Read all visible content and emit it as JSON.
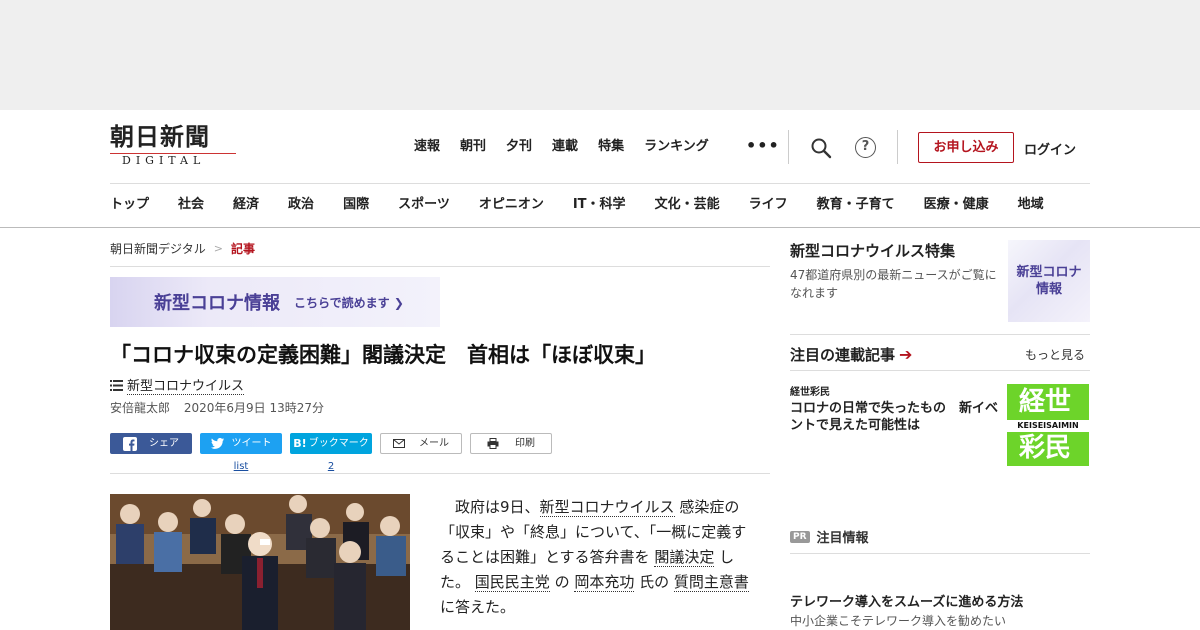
{
  "logo": {
    "kanji": "朝日新聞",
    "digital": "DIGITAL"
  },
  "topnav": [
    "速報",
    "朝刊",
    "夕刊",
    "連載",
    "特集",
    "ランキング"
  ],
  "more_glyph": "•••",
  "help_glyph": "?",
  "apply_label": "お申し込み",
  "login_label": "ログイン",
  "catnav": [
    "トップ",
    "社会",
    "経済",
    "政治",
    "国際",
    "スポーツ",
    "オピニオン",
    "IT・科学",
    "文化・芸能",
    "ライフ",
    "教育・子育て",
    "医療・健康",
    "地域"
  ],
  "breadcrumb": {
    "home": "朝日新聞デジタル",
    "sep": ">",
    "current": "記事"
  },
  "corona_banner": {
    "title": "新型コロナ情報",
    "cta": "こちらで読めます ❯"
  },
  "article": {
    "title": "「コロナ収束の定義困難」閣議決定　首相は「ほぼ収束」",
    "topic": "新型コロナウイルス",
    "author": "安倍龍太郎",
    "date": "2020年6月9日 13時27分",
    "body": {
      "p1": "政府は9日、",
      "l1": "新型コロナウイルス",
      "p2": " 感染症の「収束」や「終息」について、「一概に定義することは困難」とする答弁書を ",
      "l2": "閣議決定",
      "p3": " した。 ",
      "l3": "国民民主党",
      "p4": " の ",
      "l4": "岡本充功",
      "p5": " 氏の ",
      "l5": "質問主意書",
      "p6": " に答えた。"
    }
  },
  "share": {
    "facebook": "シェア",
    "twitter": "ツイート",
    "twitter_count": "list",
    "hatena": "ブックマーク",
    "hatena_badge": "B!",
    "hatena_count": "2",
    "mail": "メール",
    "print": "印刷"
  },
  "sidebar": {
    "feature_title": "新型コロナウイルス特集",
    "feature_desc": "47都道府県別の最新ニュースがご覧になれます",
    "feature_thumb": "新型コロナ情報",
    "series_head": "注目の連載記事",
    "more": "もっと見る",
    "series_label": "経世彩民",
    "series_title": "コロナの日常で失ったもの　新イベントで見えた可能性は",
    "series_thumb_top": "経世",
    "series_thumb_mid": "KEISEISAIMIN",
    "series_thumb_bot": "彩民",
    "pr_badge": "PR",
    "pr_head": "注目情報",
    "pr_title": "テレワーク導入をスムーズに進める方法",
    "pr_sub": "中小企業こそテレワーク導入を勧めたい"
  },
  "colors": {
    "brand_red": "#b4141e",
    "corona_purple": "#4a4096",
    "facebook": "#3b5998",
    "twitter": "#1da1f2",
    "hatena": "#00a4de"
  }
}
